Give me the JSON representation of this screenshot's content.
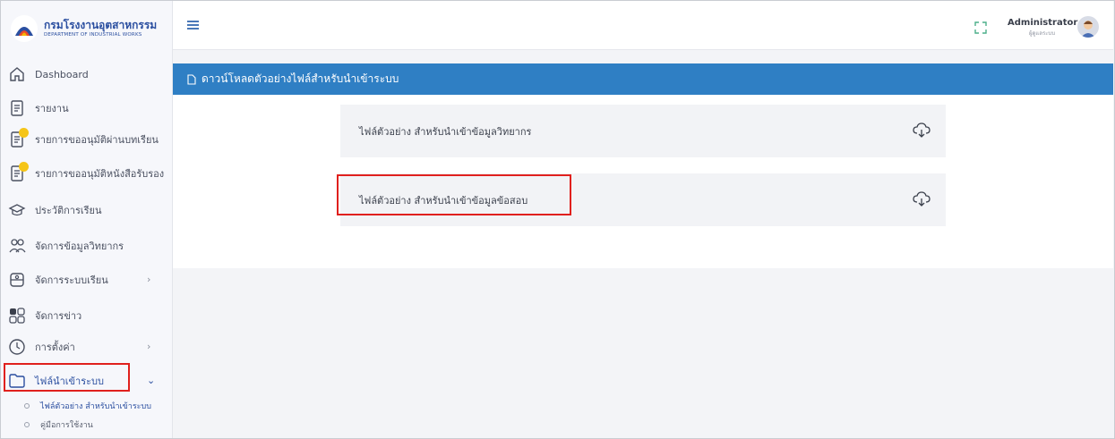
{
  "logo": {
    "thai": "กรมโรงงานอุตสาหกรรม",
    "english": "DEPARTMENT OF INDUSTRIAL WORKS"
  },
  "sidebar": {
    "items": [
      {
        "label": "Dashboard",
        "icon": "home-icon"
      },
      {
        "label": "รายงาน",
        "icon": "document-icon"
      },
      {
        "label": "รายการขออนุมัติผ่านบทเรียน",
        "icon": "document-badge-icon"
      },
      {
        "label": "รายการขออนุมัติหนังสือรับรอง",
        "icon": "document-badge-icon"
      },
      {
        "label": "ประวัติการเรียน",
        "icon": "graduation-cap-icon"
      },
      {
        "label": "จัดการข้อมูลวิทยากร",
        "icon": "users-icon"
      },
      {
        "label": "จัดการระบบเรียน",
        "icon": "classroom-icon"
      },
      {
        "label": "จัดการข่าว",
        "icon": "grid-icon"
      },
      {
        "label": "การตั้งค่า",
        "icon": "clock-icon"
      },
      {
        "label": "ไฟล์นำเข้าระบบ",
        "icon": "folder-icon"
      }
    ],
    "subitems": [
      {
        "label": "ไฟล์ตัวอย่าง สำหรับนำเข้าระบบ"
      },
      {
        "label": "คู่มือการใช้งาน"
      }
    ]
  },
  "topbar": {
    "user_name": "Administrator",
    "user_role": "ผู้ดูแลระบบ"
  },
  "card": {
    "title": "ดาวน์โหลดตัวอย่างไฟล์สำหรับนำเข้าระบบ",
    "files": [
      {
        "label": "ไฟล์ตัวอย่าง สำหรับนำเข้าข้อมูลวิทยากร"
      },
      {
        "label": "ไฟล์ตัวอย่าง สำหรับนำเข้าข้อมูลข้อสอบ"
      }
    ]
  },
  "colors": {
    "header_blue": "#2f7fc4",
    "highlight_red": "#e0201d",
    "badge_yellow": "#f5c518"
  }
}
